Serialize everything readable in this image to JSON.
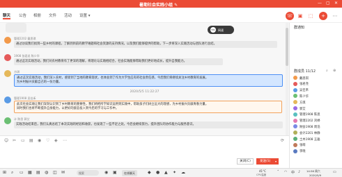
{
  "window": {
    "title": "暑期社会实践小组 ✎",
    "minimize": "—",
    "maximize": "▢",
    "close": "✕"
  },
  "tabs": [
    {
      "label": "聊天"
    },
    {
      "label": "公告"
    },
    {
      "label": "相册"
    },
    {
      "label": "文件"
    },
    {
      "label": "活动"
    },
    {
      "label": "设置 ▾"
    }
  ],
  "header_icons": [
    "phone-icon",
    "video-icon",
    "screen-share-icon",
    "add-member-icon",
    "more-icon"
  ],
  "header_icon_glyphs": [
    "☏",
    "▣",
    "⬚",
    "+",
    "⋯"
  ],
  "floating_widget": {
    "value": "58k",
    "unit": "网速"
  },
  "messages": [
    {
      "meta": "管理2202 戴思琪",
      "lines": [
        "通过访谈我们找到一些乡村的课程，了解到目前的教学难题和社会资源的支持情况，以及我们能够提供的帮助，下一步将深入实践活动与团队进行总结。"
      ],
      "style": "grey"
    },
    {
      "meta": "1908 张君尧 陈少华",
      "lines": [
        "通过这次实践活动，我们对农村教育有了更深的理解，将理论与实践相结合，社会实践能够帮助我们更好地成长，提升自我能力。"
      ],
      "style": "grey"
    },
    {
      "meta": "方琪",
      "lines": [
        "通过这次实践活动，我们深入农村，感受到了当地的教育现状，也体会到了作为大学生应有的社会责任感，今后我们将继续关注乡村教育的发展。",
        "为乡村振兴贡献自己的一份力量。"
      ],
      "style": "blue"
    },
    {
      "meta": "管理1908 吴佳禾",
      "lines": [
        "此次社会实践让我们深刻认识到了乡村教育的重要性，我们将把所学知识运用到实践中，帮助孩子们树立远大的理想，为乡村振兴贡献青春力量。",
        "同时我们也将不断提升自身能力，以更好的姿态投入到今后的学习与工作中。"
      ],
      "style": "orange"
    },
    {
      "meta": "计 陈思 郭艾",
      "lines": [
        "实践活动结束后，我们认真总结了本次实践的经验和收获，也发现了一些不足之处，今后会继续努力，提升团队的协作能力与服务意识。"
      ],
      "style": "grey"
    }
  ],
  "timestamp": "2020/5/5  11:22:27",
  "toolbar_icons": [
    "emoji-icon",
    "scissors-icon",
    "folder-icon",
    "image-icon",
    "mic-icon",
    "gift-icon",
    "red-packet-icon",
    "more-icon",
    "history-icon"
  ],
  "toolbar_glyphs": [
    "☺",
    "✂",
    "▭",
    "▤",
    "◉",
    "♡",
    "◈",
    "⋯",
    "⟳"
  ],
  "buttons": {
    "close": "关闭(C)",
    "send": "发送(S)",
    "send_arrow": "▾"
  },
  "sidebar": {
    "announcement_title": "群通知",
    "members_title": "群成员 11/12",
    "members": [
      {
        "name": "戴思琪",
        "color": "#f2994a"
      },
      {
        "name": "张君尧",
        "color": "#e55a5a"
      },
      {
        "name": "吴佳禾",
        "color": "#5a9be5"
      },
      {
        "name": "陈少华",
        "color": "#6bbf73"
      },
      {
        "name": "方琪",
        "color": "#e5b85a"
      },
      {
        "name": "郭艾",
        "color": "#9b6be5"
      },
      {
        "name": "管理1908 陈思",
        "color": "#5ac0c0"
      },
      {
        "name": "管理2202 刘婷",
        "color": "#e57ab0"
      },
      {
        "name": "财会1908 周浩",
        "color": "#7a8ae5"
      },
      {
        "name": "会计2201 林静",
        "color": "#b0b05a"
      },
      {
        "name": "土木1908 王磊",
        "color": "#5ab07a"
      },
      {
        "name": "张萌",
        "color": "#c07a5a"
      },
      {
        "name": "李晓",
        "color": "#5a7ac0"
      }
    ]
  },
  "taskbar": {
    "search": "搜索",
    "app_label": "在线聊天",
    "weather": "41°C",
    "weather_sub": "CPU温度",
    "lang": "中",
    "time": "14:56 周六",
    "date": "2020/5/9"
  },
  "colors": {
    "accent": "#eb4b35"
  }
}
